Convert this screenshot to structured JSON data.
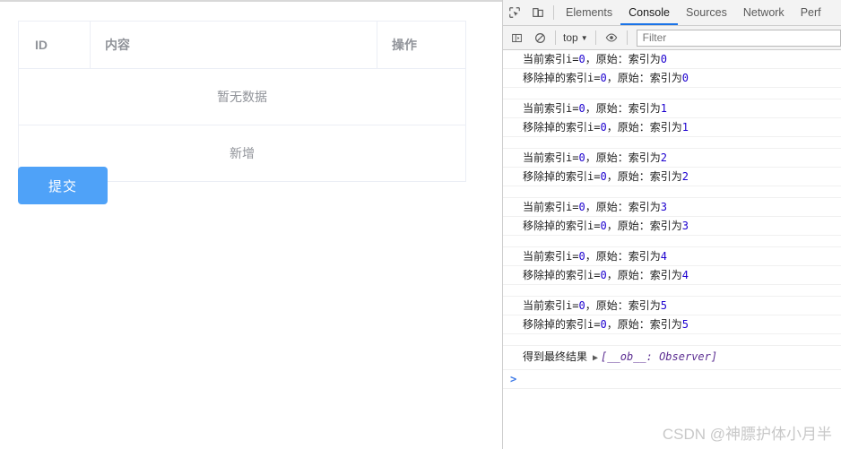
{
  "page": {
    "table": {
      "headers": [
        "ID",
        "内容",
        "操作"
      ],
      "empty_text": "暂无数据",
      "add_row_text": "新增"
    },
    "submit_label": "提交"
  },
  "devtools": {
    "toolbar_icons": [
      "inspect-element-icon",
      "device-toolbar-icon"
    ],
    "tabs": [
      {
        "label": "Elements",
        "active": false
      },
      {
        "label": "Console",
        "active": true
      },
      {
        "label": "Sources",
        "active": false
      },
      {
        "label": "Network",
        "active": false
      },
      {
        "label": "Perf",
        "active": false
      }
    ],
    "console_toolbar": {
      "sidebar_icon": "console-sidebar-icon",
      "clear_icon": "clear-console-icon",
      "context": "top",
      "context_caret": "▼",
      "eye_icon": "live-expression-eye-icon",
      "filter_placeholder": "Filter"
    },
    "logs": [
      {
        "prefix": "当前索引i=",
        "index": "0",
        "mid": "，原始：索引为",
        "value": "0"
      },
      {
        "prefix": "移除掉的索引i=",
        "index": "0",
        "mid": "，原始：索引为",
        "value": "0"
      },
      {
        "spacer": true
      },
      {
        "prefix": "当前索引i=",
        "index": "0",
        "mid": "，原始：索引为",
        "value": "1"
      },
      {
        "prefix": "移除掉的索引i=",
        "index": "0",
        "mid": "，原始：索引为",
        "value": "1"
      },
      {
        "spacer": true
      },
      {
        "prefix": "当前索引i=",
        "index": "0",
        "mid": "，原始：索引为",
        "value": "2"
      },
      {
        "prefix": "移除掉的索引i=",
        "index": "0",
        "mid": "，原始：索引为",
        "value": "2"
      },
      {
        "spacer": true
      },
      {
        "prefix": "当前索引i=",
        "index": "0",
        "mid": "，原始：索引为",
        "value": "3"
      },
      {
        "prefix": "移除掉的索引i=",
        "index": "0",
        "mid": "，原始：索引为",
        "value": "3"
      },
      {
        "spacer": true
      },
      {
        "prefix": "当前索引i=",
        "index": "0",
        "mid": "，原始：索引为",
        "value": "4"
      },
      {
        "prefix": "移除掉的索引i=",
        "index": "0",
        "mid": "，原始：索引为",
        "value": "4"
      },
      {
        "spacer": true
      },
      {
        "prefix": "当前索引i=",
        "index": "0",
        "mid": "，原始：索引为",
        "value": "5"
      },
      {
        "prefix": "移除掉的索引i=",
        "index": "0",
        "mid": "，原始：索引为",
        "value": "5"
      },
      {
        "spacer": true
      }
    ],
    "final_log": {
      "label": "得到最终结果",
      "disclosure": "▶",
      "object": "[__ob__: Observer]"
    },
    "prompt_caret": ">"
  },
  "watermark": "CSDN @神膘护体小月半",
  "colors": {
    "primary": "#4fa2f8",
    "tab_active_underline": "#1a73e8",
    "table_border": "#ebeef5",
    "muted_text": "#909399",
    "log_number": "#1c00cf",
    "object_ref": "#5b2d91",
    "prompt": "#3b78e7",
    "watermark": "#c8c8c8"
  }
}
